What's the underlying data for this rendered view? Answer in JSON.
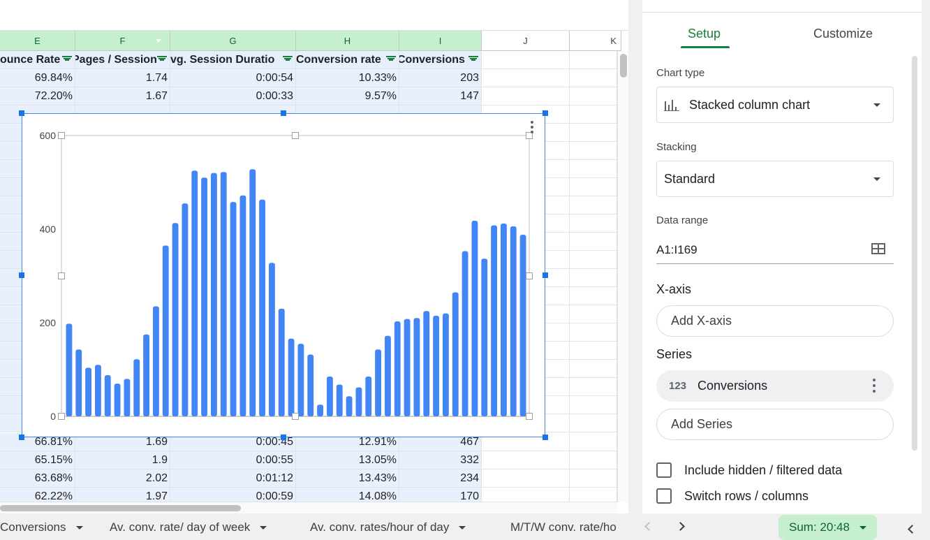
{
  "spreadsheet": {
    "columns": [
      "E",
      "F",
      "G",
      "H",
      "I",
      "J",
      "K"
    ],
    "headers": [
      "ounce Rate",
      "Pages / Session",
      "vg. Session Duratio",
      "Conversion rate",
      "Conversions"
    ],
    "rows_top": [
      [
        "69.84%",
        "1.74",
        "0:00:54",
        "10.33%",
        "203"
      ],
      [
        "72.20%",
        "1.67",
        "0:00:33",
        "9.57%",
        "147"
      ]
    ],
    "rows_bottom": [
      [
        "66.81%",
        "1.69",
        "0:00:45",
        "12.91%",
        "467"
      ],
      [
        "65.15%",
        "1.9",
        "0:00:55",
        "13.05%",
        "332"
      ],
      [
        "63.68%",
        "2.02",
        "0:01:12",
        "13.43%",
        "234"
      ],
      [
        "62.22%",
        "1.97",
        "0:00:59",
        "14.08%",
        "170"
      ]
    ]
  },
  "chart_data": {
    "type": "bar",
    "stacking": "standard",
    "series": [
      {
        "name": "Conversions",
        "values": [
          198,
          143,
          104,
          110,
          88,
          70,
          80,
          122,
          175,
          235,
          365,
          413,
          455,
          525,
          510,
          520,
          522,
          458,
          472,
          528,
          463,
          328,
          230,
          166,
          155,
          132,
          25,
          85,
          68,
          43,
          62,
          85,
          143,
          172,
          203,
          208,
          210,
          225,
          215,
          220,
          265,
          353,
          418,
          337,
          408,
          412,
          406,
          388
        ]
      }
    ],
    "ylim": [
      0,
      600
    ],
    "yticks": [
      "0",
      "200",
      "400",
      "600"
    ],
    "color": "#4285f4"
  },
  "panel": {
    "tabs": [
      "Setup",
      "Customize"
    ],
    "chart_type_label": "Chart type",
    "chart_type_value": "Stacked column chart",
    "stacking_label": "Stacking",
    "stacking_value": "Standard",
    "data_range_label": "Data range",
    "data_range_value": "A1:I169",
    "xaxis_heading": "X-axis",
    "add_xaxis": "Add X-axis",
    "series_heading": "Series",
    "series_icon_text": "123",
    "series_name": "Conversions",
    "add_series": "Add Series",
    "include_hidden": "Include hidden / filtered data",
    "switch_rows": "Switch rows / columns"
  },
  "tabs": {
    "items": [
      "Conversions",
      "Av. conv. rate/ day of week",
      "Av. conv. rates/hour of day",
      "M/T/W conv. rate/ho"
    ],
    "sum": "Sum: 20:48"
  },
  "colors": {
    "accent": "#188038",
    "selection": "#1a73e8",
    "bar": "#4285f4"
  }
}
